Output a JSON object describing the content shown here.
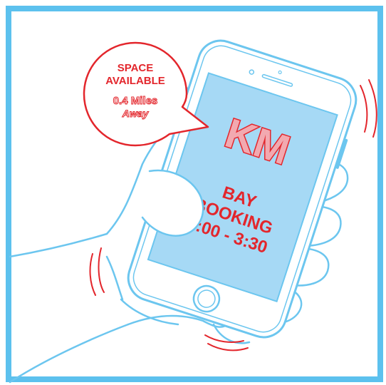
{
  "colors": {
    "frame": "#5cc1ee",
    "line": "#6cc6ef",
    "screen": "#a6d9f5",
    "accent": "#e3262c"
  },
  "bubble": {
    "title_line1": "SPACE",
    "title_line2": "AVAILABLE",
    "distance_line1": "0.4 Miles",
    "distance_line2": "Away"
  },
  "phone": {
    "logo": "KM",
    "line1": "BAY",
    "line2": "BOOKING",
    "line3": "3:00 - 3:30"
  }
}
